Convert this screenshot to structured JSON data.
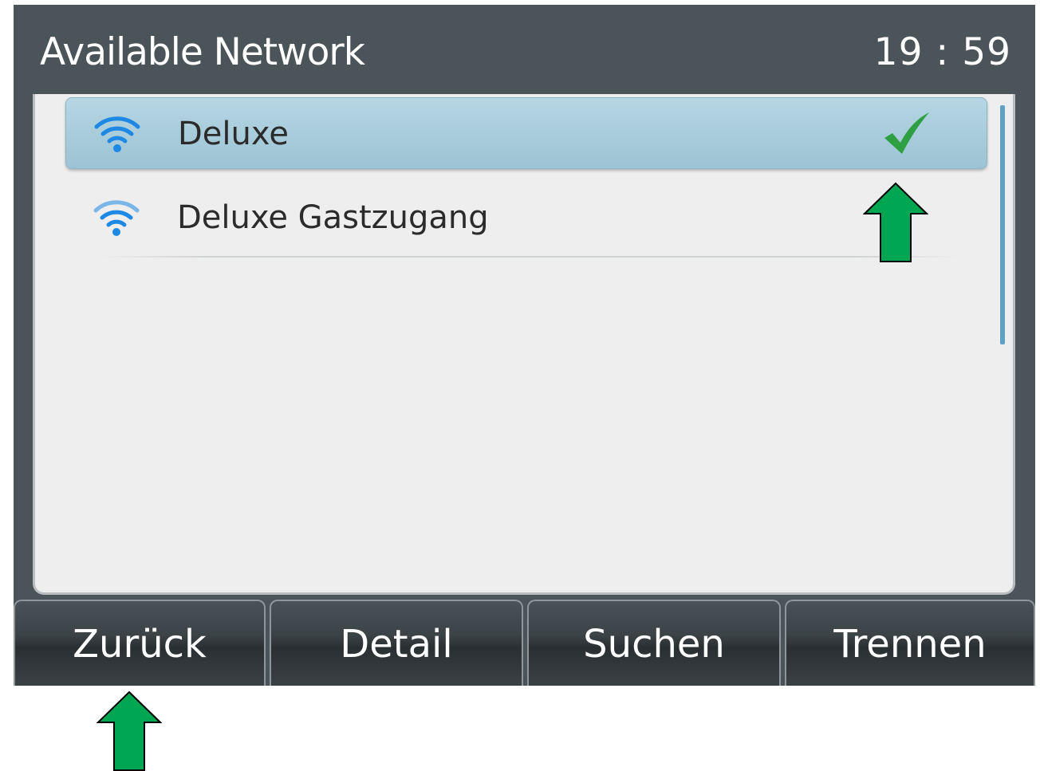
{
  "header": {
    "title": "Available Network",
    "clock": "19 : 59"
  },
  "networks": [
    {
      "name": "Deluxe",
      "selected": true,
      "connected": true,
      "icon": "wifi-icon"
    },
    {
      "name": "Deluxe Gastzugang",
      "selected": false,
      "connected": false,
      "icon": "wifi-icon"
    }
  ],
  "softkeys": [
    {
      "label": "Zurück"
    },
    {
      "label": "Detail"
    },
    {
      "label": "Suchen"
    },
    {
      "label": "Trennen"
    }
  ],
  "colors": {
    "wifi": "#1e88e5",
    "check": "#2ea043",
    "annotation_arrow": "#00a651",
    "selection": "#a8cddd",
    "header": "#4b5559"
  }
}
